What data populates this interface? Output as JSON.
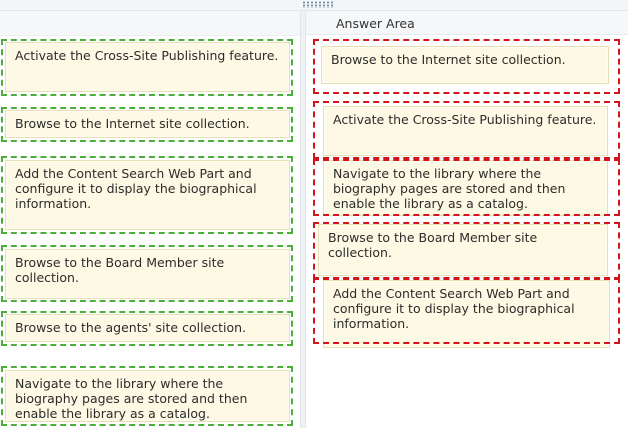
{
  "answer_area": {
    "title": "Answer Area"
  },
  "source_items": [
    {
      "label": "Activate the Cross-Site Publishing feature."
    },
    {
      "label": "Browse to the Internet site collection."
    },
    {
      "label": "Add the Content Search Web Part and configure it to display the biographical information."
    },
    {
      "label": "Browse to the Board Member site collection."
    },
    {
      "label": "Browse to the agents' site collection."
    },
    {
      "label": "Navigate to the library where the biography pages are stored and then enable the library as a catalog."
    }
  ],
  "answer_items": [
    {
      "label": "Browse to the Internet site collection."
    },
    {
      "label": "Activate the Cross-Site Publishing feature."
    },
    {
      "label": "Navigate to the library where the biography pages are stored and then enable the library as a catalog."
    },
    {
      "label": "Browse to the Board Member site collection."
    },
    {
      "label": "Add the Content Search Web Part and configure it to display the biographical information."
    }
  ],
  "colors": {
    "source_outline": "#4caf3b",
    "answer_outline": "#d1151b",
    "card_fill": "#fdf9e4"
  }
}
